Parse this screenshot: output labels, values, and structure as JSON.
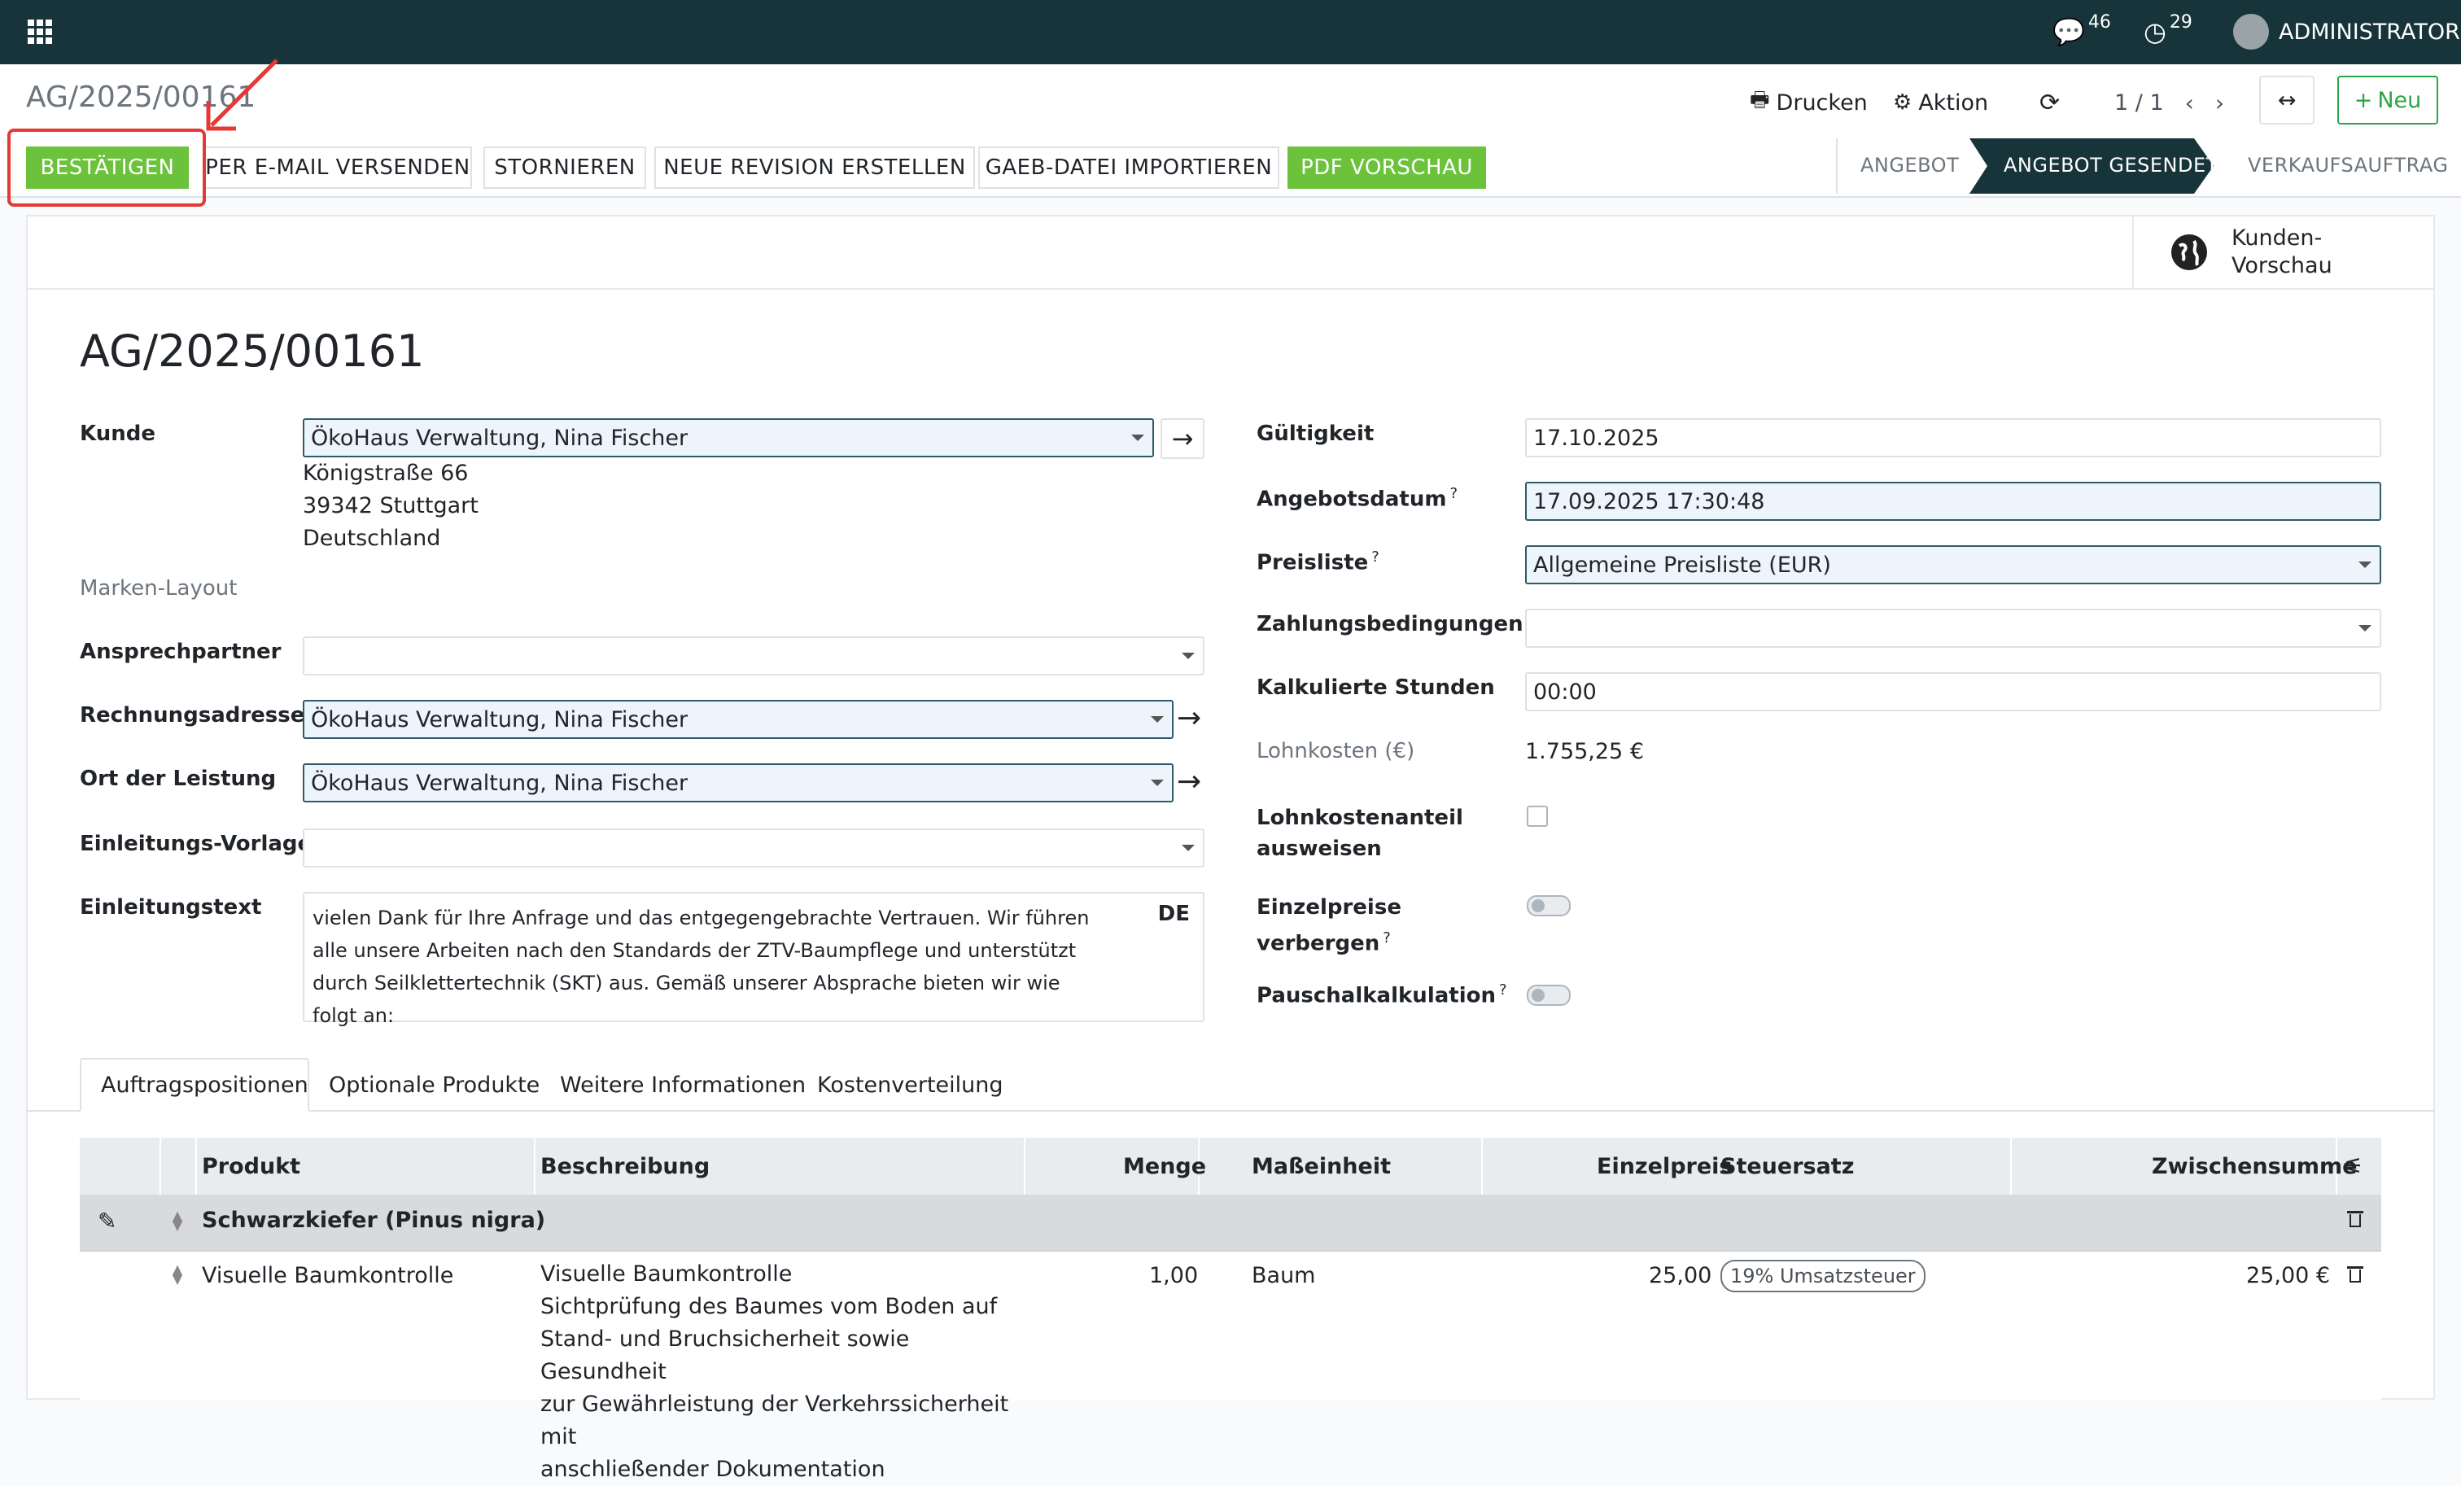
{
  "navbar": {
    "messages_count": "46",
    "activities_count": "29",
    "user": "ADMINISTRATOR"
  },
  "control_panel": {
    "record_name": "AG/2025/00161",
    "print_label": "Drucken",
    "action_label": "Aktion",
    "pager": "1 / 1",
    "new_label": "Neu"
  },
  "actions": {
    "confirm": "BESTÄTIGEN",
    "send_email": "PER E-MAIL VERSENDEN",
    "cancel": "STORNIEREN",
    "new_revision": "NEUE REVISION ERSTELLEN",
    "gaeb_import": "GAEB-DATEI IMPORTIEREN",
    "pdf_preview": "PDF VORSCHAU"
  },
  "statusbar": {
    "stages": [
      "ANGEBOT",
      "ANGEBOT GESENDET",
      "VERKAUFSAUFTRAG"
    ],
    "active": "ANGEBOT GESENDET"
  },
  "preview": {
    "line1": "Kunden-",
    "line2": "Vorschau"
  },
  "form": {
    "title": "AG/2025/00161",
    "customer_label": "Kunde",
    "customer": "ÖkoHaus Verwaltung, Nina Fischer",
    "address": [
      "Königstraße 66",
      "39342 Stuttgart",
      "Deutschland"
    ],
    "brand_layout_label": "Marken-Layout",
    "contact_label": "Ansprechpartner",
    "contact": "",
    "invoice_address_label": "Rechnungsadresse",
    "invoice_address": "ÖkoHaus Verwaltung, Nina Fischer",
    "delivery_label": "Ort der Leistung",
    "delivery": "ÖkoHaus Verwaltung, Nina Fischer",
    "intro_template_label": "Einleitungs-Vorlage",
    "intro_template": "",
    "intro_text_label": "Einleitungstext",
    "intro_text": "vielen Dank für Ihre Anfrage und das entgegengebrachte Vertrauen. Wir führen alle unsere Arbeiten nach den Standards der ZTV-Baumpflege und unterstützt durch Seilklettertechnik (SKT) aus. Gemäß unserer Absprache bieten wir wie folgt an:",
    "intro_lang": "DE",
    "validity_label": "Gültigkeit",
    "validity": "17.10.2025",
    "quote_date_label": "Angebotsdatum",
    "quote_date": "17.09.2025 17:30:48",
    "pricelist_label": "Preisliste",
    "pricelist": "Allgemeine Preisliste (EUR)",
    "payment_terms_label": "Zahlungsbedingungen",
    "payment_terms": "",
    "hours_label": "Kalkulierte Stunden",
    "hours": "00:00",
    "labor_cost_label": "Lohnkosten (€)",
    "labor_cost": "1.755,25 €",
    "labor_share_label_1": "Lohnkostenanteil",
    "labor_share_label_2": "ausweisen",
    "hide_prices_label_1": "Einzelpreise",
    "hide_prices_label_2": "verbergen",
    "flat_calc_label": "Pauschalkalkulation",
    "help_mark": "?"
  },
  "tabs": [
    "Auftragspositionen",
    "Optionale Produkte",
    "Weitere Informationen",
    "Kostenverteilung"
  ],
  "table": {
    "headers": {
      "product": "Produkt",
      "description": "Beschreibung",
      "quantity": "Menge",
      "uom": "Maßeinheit",
      "unit_price": "Einzelpreis",
      "tax": "Steuersatz",
      "subtotal": "Zwischensumme"
    },
    "section": "Schwarzkiefer (Pinus nigra)",
    "rows": [
      {
        "product": "Visuelle Baumkontrolle",
        "description": "Visuelle Baumkontrolle\nSichtprüfung des Baumes vom Boden auf\nStand- und Bruchsicherheit sowie Gesundheit\nzur Gewährleistung der Verkehrssicherheit mit\nanschließender Dokumentation",
        "quantity": "1,00",
        "uom": "Baum",
        "unit_price": "25,00",
        "tax": "19% Umsatzsteuer",
        "subtotal": "25,00 €"
      }
    ]
  }
}
